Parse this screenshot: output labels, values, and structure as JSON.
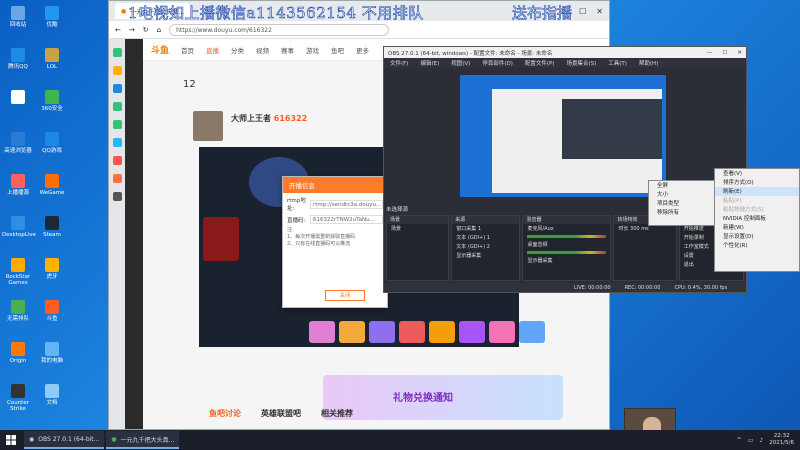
{
  "overlay": {
    "headline": "1电视如上播微信a1143562154 不用排队",
    "headline_right": "送布指播"
  },
  "desktop_icons": [
    {
      "label": "回收站",
      "color": "#6ba6e8"
    },
    {
      "label": "腾讯QQ",
      "color": "#1c8ce6"
    },
    {
      "label": "",
      "color": "#ffffff"
    },
    {
      "label": "高速浏览器",
      "color": "#2a7bd6"
    },
    {
      "label": "上播播源",
      "color": "#ff5f5f"
    },
    {
      "label": "DesktopLive",
      "color": "#2d8fe0"
    },
    {
      "label": "RockStar Games",
      "color": "#ffaa00"
    },
    {
      "label": "无需排队",
      "color": "#4caf50"
    },
    {
      "label": "Origin",
      "color": "#ff7a00"
    },
    {
      "label": "Counter Strike",
      "color": "#333333"
    },
    {
      "label": "优酷",
      "color": "#2196f3"
    },
    {
      "label": "LOL",
      "color": "#c8a24a"
    },
    {
      "label": "360安全",
      "color": "#3fb54a"
    },
    {
      "label": "QQ游戏",
      "color": "#1e88e5"
    },
    {
      "label": "WeGame",
      "color": "#ff6f00"
    },
    {
      "label": "Steam",
      "color": "#1b2838"
    },
    {
      "label": "虎牙",
      "color": "#ffb300"
    },
    {
      "label": "斗鱼",
      "color": "#ff5d23"
    },
    {
      "label": "我的电脑",
      "color": "#64b5f6"
    },
    {
      "label": "文档",
      "color": "#90caf9"
    }
  ],
  "browser": {
    "tab_title": "一元九千把大头真…",
    "url": "https://www.douyu.com/616322",
    "nav": {
      "logo": "斗鱼",
      "items": [
        "首页",
        "直播",
        "分类",
        "视频",
        "赛事",
        "游戏",
        "鱼吧",
        "更多"
      ],
      "active_index": 1
    },
    "streamer": {
      "name": "大师上王者",
      "room": "616322",
      "followers": "12"
    },
    "bottom_tabs": [
      "鱼吧讨论",
      "英雄联盟吧",
      "相关推荐"
    ],
    "banner_text": "礼物兑换通知"
  },
  "dialog": {
    "title": "开播信息",
    "rtmp_label": "rtmp地址:",
    "rtmp_value": "rtmp://sendtc3a.douyu...",
    "key_label": "直播码:",
    "key_value": "616322rTNW2uTaNu...",
    "notes": [
      "注:",
      "1、每次开播需重新获取直播码",
      "2、只有在线直播码可以推流"
    ],
    "button": "关闭"
  },
  "obs": {
    "title": "OBS 27.0.1 (64-bit, windows) - 配置文件: 未命名 - 场景: 未命名",
    "menu": [
      "文件(F)",
      "编辑(E)",
      "视图(V)",
      "停靠部件(D)",
      "配置文件(P)",
      "场景集合(S)",
      "工具(T)",
      "帮助(H)"
    ],
    "scene_label": "未选择源",
    "docks": {
      "scenes": {
        "header": "场景",
        "items": [
          "场景"
        ]
      },
      "sources": {
        "header": "来源",
        "items": [
          "窗口采集 1",
          "文本 (GDI+) 1",
          "文本 (GDI+) 2",
          "显示器采集"
        ]
      },
      "mixer": {
        "header": "混音器",
        "items": [
          "麦克风/Aux",
          "桌面音频",
          "显示器采集"
        ]
      },
      "transitions": {
        "header": "转场特效",
        "items": [
          "时长 300 ms"
        ]
      },
      "controls": {
        "header": "控件",
        "items": [
          "开始推流",
          "开始录制",
          "工作室模式",
          "设置",
          "退出"
        ]
      }
    },
    "status": [
      "LIVE: 00:00:00",
      "REC: 00:00:00",
      "CPU: 0.4%, 30.00 fps"
    ]
  },
  "context_menu_left": [
    {
      "label": "全屏",
      "state": "normal"
    },
    {
      "label": "大小",
      "state": "normal"
    },
    {
      "label": "项目类型",
      "state": "normal"
    },
    {
      "label": "移除所有",
      "state": "normal"
    }
  ],
  "context_menu_right": [
    {
      "label": "查看(V)",
      "state": "normal"
    },
    {
      "label": "排序方式(O)",
      "state": "normal"
    },
    {
      "label": "刷新(E)",
      "state": "highlight"
    },
    {
      "label": "粘贴(P)",
      "state": "disabled"
    },
    {
      "label": "粘贴快捷方式(S)",
      "state": "disabled"
    },
    {
      "label": "NVIDIA 控制面板",
      "state": "normal"
    },
    {
      "label": "新建(W)",
      "state": "normal"
    },
    {
      "label": "显示设置(D)",
      "state": "normal"
    },
    {
      "label": "个性化(R)",
      "state": "normal"
    }
  ],
  "taskbar": {
    "items": [
      "OBS 27.0.1 (64-bit...",
      "一元九千把大头真..."
    ],
    "time": "22:32",
    "date": "2021/5/6"
  }
}
